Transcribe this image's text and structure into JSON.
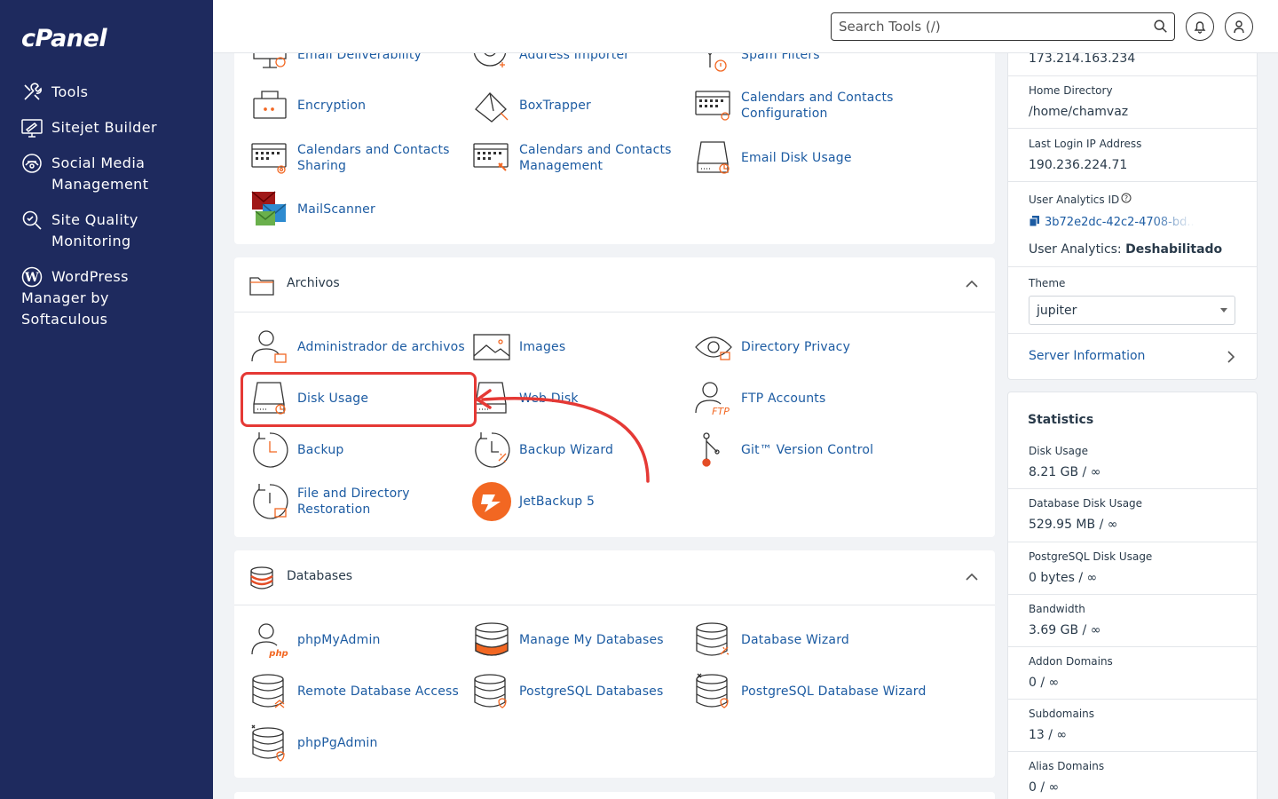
{
  "brand": {
    "logo": "cPanel"
  },
  "sidebar": {
    "items": [
      {
        "label": "Tools",
        "icon": "tools-icon"
      },
      {
        "label": "Sitejet Builder",
        "icon": "sitejet-icon"
      },
      {
        "label": "Social Media\nManagement",
        "icon": "social-media-icon"
      },
      {
        "label": "Site Quality\nMonitoring",
        "icon": "site-quality-icon"
      },
      {
        "label": "WordPress\nManager by\nSoftaculous",
        "icon": "wordpress-icon"
      }
    ]
  },
  "header": {
    "search_placeholder": "Search Tools (/)",
    "icons": [
      "search-icon",
      "bell-icon",
      "user-icon"
    ]
  },
  "email_section": {
    "tools": [
      {
        "label": "Email Deliverability",
        "icon": "email-deliverability-icon"
      },
      {
        "label": "Address Importer",
        "icon": "address-importer-icon"
      },
      {
        "label": "Spam Filters",
        "icon": "spam-filters-icon"
      },
      {
        "label": "Encryption",
        "icon": "encryption-icon"
      },
      {
        "label": "BoxTrapper",
        "icon": "boxtrapper-icon"
      },
      {
        "label": "Calendars and Contacts\nConfiguration",
        "icon": "calendar-config-icon"
      },
      {
        "label": "Calendars and Contacts\nSharing",
        "icon": "calendar-sharing-icon"
      },
      {
        "label": "Calendars and Contacts\nManagement",
        "icon": "calendar-management-icon"
      },
      {
        "label": "Email Disk Usage",
        "icon": "email-disk-usage-icon"
      },
      {
        "label": "MailScanner",
        "icon": "mailscanner-icon"
      }
    ]
  },
  "files_section": {
    "title": "Archivos",
    "tools": [
      {
        "label": "Administrador de archivos",
        "icon": "file-manager-icon"
      },
      {
        "label": "Images",
        "icon": "images-icon"
      },
      {
        "label": "Directory Privacy",
        "icon": "directory-privacy-icon"
      },
      {
        "label": "Disk Usage",
        "icon": "disk-usage-icon"
      },
      {
        "label": "Web Disk",
        "icon": "web-disk-icon"
      },
      {
        "label": "FTP Accounts",
        "icon": "ftp-accounts-icon"
      },
      {
        "label": "Backup",
        "icon": "backup-icon"
      },
      {
        "label": "Backup Wizard",
        "icon": "backup-wizard-icon"
      },
      {
        "label": "Git™ Version Control",
        "icon": "git-icon"
      },
      {
        "label": "File and Directory\nRestoration",
        "icon": "restoration-icon"
      },
      {
        "label": "JetBackup 5",
        "icon": "jetbackup-icon"
      }
    ]
  },
  "databases_section": {
    "title": "Databases",
    "tools": [
      {
        "label": "phpMyAdmin",
        "icon": "phpmyadmin-icon"
      },
      {
        "label": "Manage My Databases",
        "icon": "manage-databases-icon"
      },
      {
        "label": "Database Wizard",
        "icon": "database-wizard-icon"
      },
      {
        "label": "Remote Database Access",
        "icon": "remote-database-icon"
      },
      {
        "label": "PostgreSQL Databases",
        "icon": "postgresql-databases-icon"
      },
      {
        "label": "PostgreSQL Database Wizard",
        "icon": "postgresql-wizard-icon"
      },
      {
        "label": "phpPgAdmin",
        "icon": "phppgadmin-icon"
      }
    ]
  },
  "general_info": {
    "shared_ip": "173.214.163.234",
    "home_directory_label": "Home Directory",
    "home_directory": "/home/chamvaz",
    "last_login_label": "Last Login IP Address",
    "last_login": "190.236.224.71",
    "analytics_id_label": "User Analytics ID",
    "analytics_id": "3b72e2dc-42c2-4708-bd...",
    "analytics_status_label": "User Analytics:",
    "analytics_status": "Deshabilitado",
    "theme_label": "Theme",
    "theme_value": "jupiter",
    "server_info": "Server Information"
  },
  "statistics": {
    "title": "Statistics",
    "items": [
      {
        "label": "Disk Usage",
        "value": "8.21 GB / ∞"
      },
      {
        "label": "Database Disk Usage",
        "value": "529.95 MB / ∞"
      },
      {
        "label": "PostgreSQL Disk Usage",
        "value": "0 bytes / ∞"
      },
      {
        "label": "Bandwidth",
        "value": "3.69 GB / ∞"
      },
      {
        "label": "Addon Domains",
        "value": "0 / ∞"
      },
      {
        "label": "Subdomains",
        "value": "13 / ∞"
      },
      {
        "label": "Alias Domains",
        "value": "0 / ∞"
      }
    ]
  },
  "colors": {
    "sidebar_bg": "#1e2a5e",
    "link": "#1c5ba2",
    "accent_orange": "#f26722",
    "annotation_red": "#e53935"
  }
}
